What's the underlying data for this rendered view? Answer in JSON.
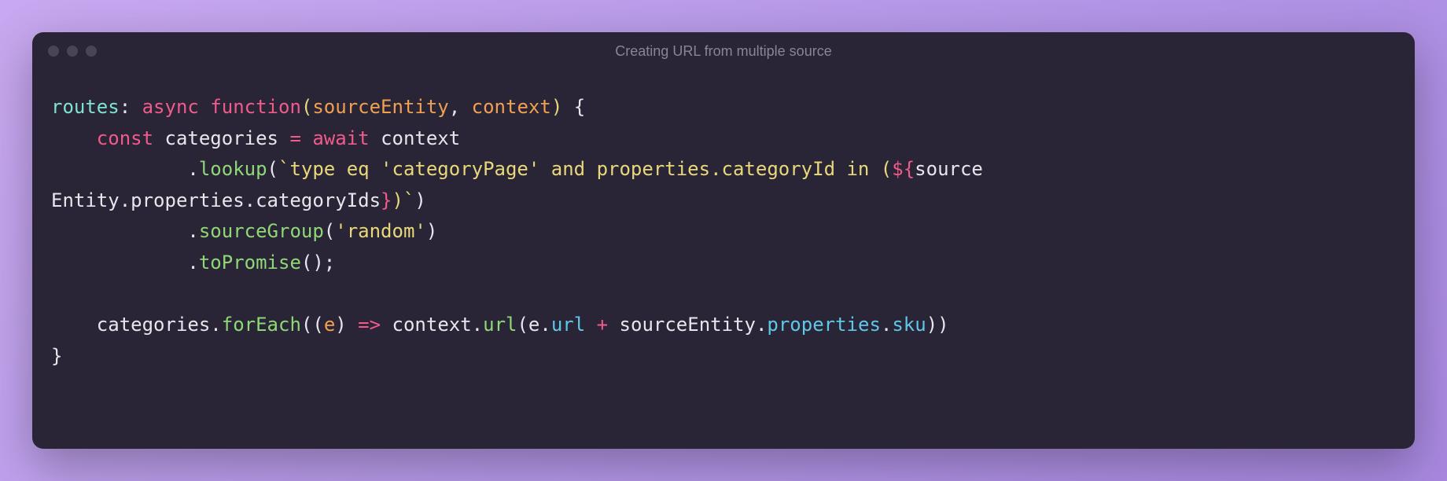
{
  "window": {
    "title": "Creating URL from multiple source"
  },
  "code": {
    "tokens": [
      [
        {
          "t": "routes",
          "c": "teal"
        },
        {
          "t": ": ",
          "c": "default"
        },
        {
          "t": "async ",
          "c": "pink"
        },
        {
          "t": "function",
          "c": "pink"
        },
        {
          "t": "(",
          "c": "yellow"
        },
        {
          "t": "sourceEntity",
          "c": "orange"
        },
        {
          "t": ", ",
          "c": "default"
        },
        {
          "t": "context",
          "c": "orange"
        },
        {
          "t": ") ",
          "c": "yellow"
        },
        {
          "t": "{",
          "c": "default"
        }
      ],
      [
        {
          "t": "    ",
          "c": "default"
        },
        {
          "t": "const ",
          "c": "pink"
        },
        {
          "t": "categories ",
          "c": "default"
        },
        {
          "t": "=",
          "c": "pink"
        },
        {
          "t": " ",
          "c": "default"
        },
        {
          "t": "await ",
          "c": "pink"
        },
        {
          "t": "context",
          "c": "default"
        }
      ],
      [
        {
          "t": "            .",
          "c": "default"
        },
        {
          "t": "lookup",
          "c": "green"
        },
        {
          "t": "(",
          "c": "default"
        },
        {
          "t": "`type eq 'categoryPage' and properties.categoryId in (",
          "c": "yellow"
        },
        {
          "t": "${",
          "c": "pink"
        },
        {
          "t": "sourceEntity.properties.categoryIds",
          "c": "default"
        },
        {
          "t": "}",
          "c": "pink"
        },
        {
          "t": ")`",
          "c": "yellow"
        },
        {
          "t": ")",
          "c": "default"
        }
      ],
      [
        {
          "t": "            .",
          "c": "default"
        },
        {
          "t": "sourceGroup",
          "c": "green"
        },
        {
          "t": "(",
          "c": "default"
        },
        {
          "t": "'random'",
          "c": "yellow"
        },
        {
          "t": ")",
          "c": "default"
        }
      ],
      [
        {
          "t": "            .",
          "c": "default"
        },
        {
          "t": "toPromise",
          "c": "green"
        },
        {
          "t": "();",
          "c": "default"
        }
      ],
      [
        {
          "t": "",
          "c": "default"
        }
      ],
      [
        {
          "t": "    categories.",
          "c": "default"
        },
        {
          "t": "forEach",
          "c": "green"
        },
        {
          "t": "((",
          "c": "default"
        },
        {
          "t": "e",
          "c": "orange"
        },
        {
          "t": ") ",
          "c": "default"
        },
        {
          "t": "=>",
          "c": "pink"
        },
        {
          "t": " context.",
          "c": "default"
        },
        {
          "t": "url",
          "c": "green"
        },
        {
          "t": "(e.",
          "c": "default"
        },
        {
          "t": "url",
          "c": "blue"
        },
        {
          "t": " ",
          "c": "default"
        },
        {
          "t": "+",
          "c": "pink"
        },
        {
          "t": " sourceEntity.",
          "c": "default"
        },
        {
          "t": "properties",
          "c": "blue"
        },
        {
          "t": ".",
          "c": "default"
        },
        {
          "t": "sku",
          "c": "blue"
        },
        {
          "t": "))",
          "c": "default"
        }
      ],
      [
        {
          "t": "}",
          "c": "default"
        }
      ]
    ]
  }
}
